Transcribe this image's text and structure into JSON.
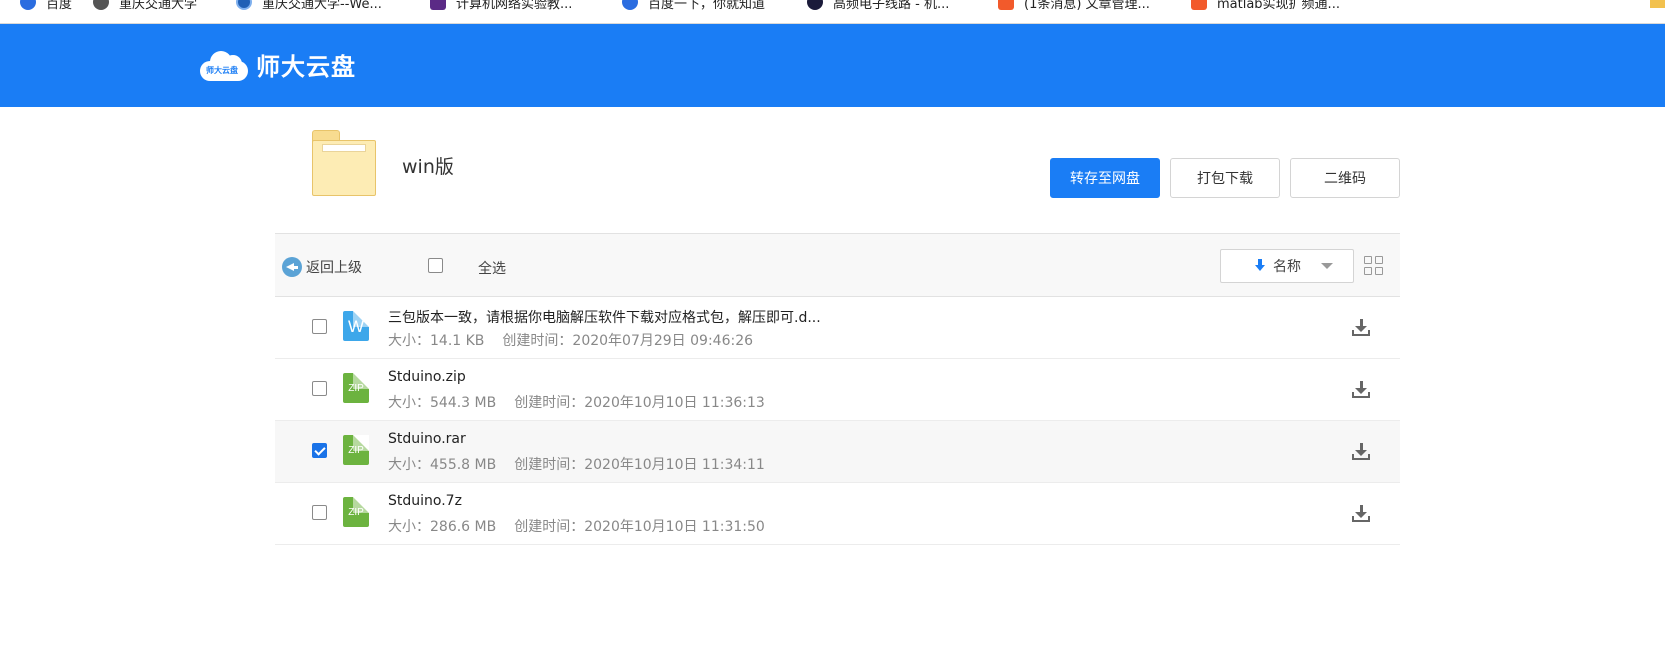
{
  "bookmarks": [
    {
      "label": "百度",
      "icon": "paw-icon"
    },
    {
      "label": "重庆交通大学",
      "icon": "globe-icon"
    },
    {
      "label": "重庆交通大学--We...",
      "icon": "school-badge-icon"
    },
    {
      "label": "计算机网络实验教...",
      "icon": "w-logo-icon"
    },
    {
      "label": "百度一下，你就知道",
      "icon": "paw-icon"
    },
    {
      "label": "高频电子线路 - 机...",
      "icon": "dark-circle-icon"
    },
    {
      "label": "(1条消息) 文章管理...",
      "icon": "csdn-c-icon"
    },
    {
      "label": "matlab实现扩频通...",
      "icon": "csdn-c-icon"
    }
  ],
  "header": {
    "logo_badge": "师大云盘",
    "title": "师大云盘",
    "background": "#1a7df5"
  },
  "folder": {
    "name": "win版",
    "icon": "folder-icon"
  },
  "actions": {
    "save_to_drive": "转存至网盘",
    "pack_download": "打包下载",
    "qr_code": "二维码"
  },
  "toolbar": {
    "back_label": "返回上级",
    "select_all_label": "全选",
    "sort_label": "名称"
  },
  "files": [
    {
      "name": "三包版本一致，请根据你电脑解压软件下载对应格式包，解压即可.d...",
      "size": "大小：14.1 KB",
      "created": "创建时间：2020年07月29日 09:46:26",
      "type": "doc",
      "icon_label": "W",
      "checked": false
    },
    {
      "name": "Stduino.zip",
      "size": "大小：544.3 MB",
      "created": "创建时间：2020年10月10日 11:36:13",
      "type": "zip",
      "icon_label": "ZIP",
      "checked": false
    },
    {
      "name": "Stduino.rar",
      "size": "大小：455.8 MB",
      "created": "创建时间：2020年10月10日 11:34:11",
      "type": "zip",
      "icon_label": "ZIP",
      "checked": true
    },
    {
      "name": "Stduino.7z",
      "size": "大小：286.6 MB",
      "created": "创建时间：2020年10月10日 11:31:50",
      "type": "zip",
      "icon_label": "ZIP",
      "checked": false
    }
  ]
}
